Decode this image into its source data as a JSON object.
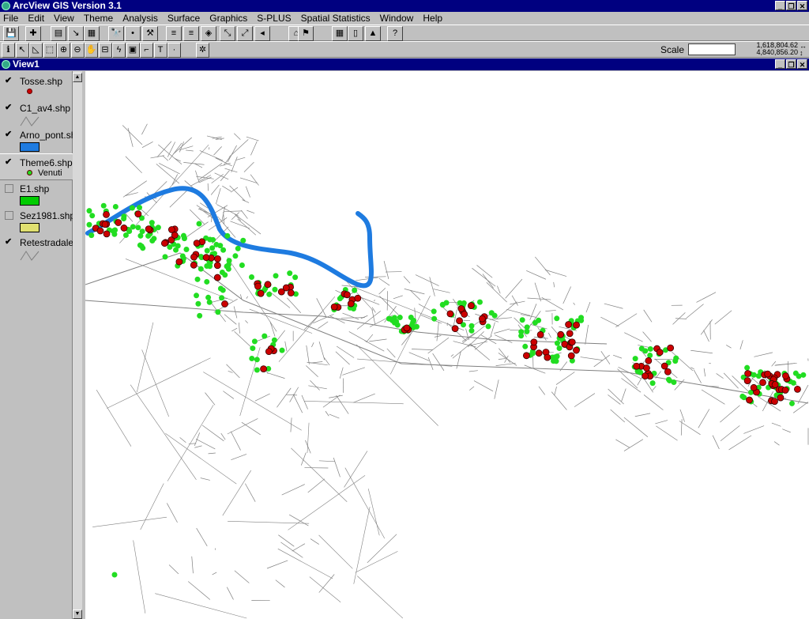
{
  "app": {
    "title": "ArcView GIS Version 3.1",
    "window_buttons": [
      "_",
      "❐",
      "✕"
    ]
  },
  "menu": [
    "File",
    "Edit",
    "View",
    "Theme",
    "Analysis",
    "Surface",
    "Graphics",
    "S-PLUS",
    "Spatial Statistics",
    "Window",
    "Help"
  ],
  "toolbar1": [
    "save",
    "add-theme",
    "theme-properties",
    "edit-legend",
    "open-table",
    "find",
    "locate",
    "query-builder",
    "zoom-full",
    "zoom-active",
    "zoom-selected",
    "zoom-in",
    "zoom-out",
    "zoom-previous",
    "hotlink",
    "flag",
    "layout",
    "table",
    "chart",
    "help"
  ],
  "toolbar2": [
    "identify",
    "pointer",
    "vertex-edit",
    "select-feature",
    "zoom-in-tool",
    "zoom-out-tool",
    "pan",
    "measure",
    "hotlink-tool",
    "area-select",
    "label",
    "text",
    "draw-point",
    "spatial-tool"
  ],
  "scale": {
    "label": "Scale",
    "value": "",
    "x": "1,618,804.62",
    "y": "4,840,856.20"
  },
  "view": {
    "title": "View1"
  },
  "legend": [
    {
      "name": "Tosse.shp",
      "checked": true,
      "symbol": "point",
      "color": "#cc0000"
    },
    {
      "name": "C1_av4.shp",
      "checked": true,
      "symbol": "line",
      "color": "#808080"
    },
    {
      "name": "Arno_pont.shp",
      "checked": true,
      "symbol": "fill",
      "color": "#1e7be0"
    },
    {
      "name": "Theme6.shp",
      "checked": true,
      "symbol": "point",
      "color": "#22dd22",
      "sublabel": "Venuti"
    },
    {
      "name": "E1.shp",
      "checked": false,
      "symbol": "fill",
      "color": "#00cc00"
    },
    {
      "name": "Sez1981.shp",
      "checked": false,
      "symbol": "fill",
      "color": "#e0e070"
    },
    {
      "name": "Retestradale",
      "checked": true,
      "symbol": "line",
      "color": "#808080"
    }
  ],
  "colors": {
    "river": "#1e7be0",
    "cases": "#cc0000",
    "controls": "#22dd22",
    "roads": "#808080"
  }
}
